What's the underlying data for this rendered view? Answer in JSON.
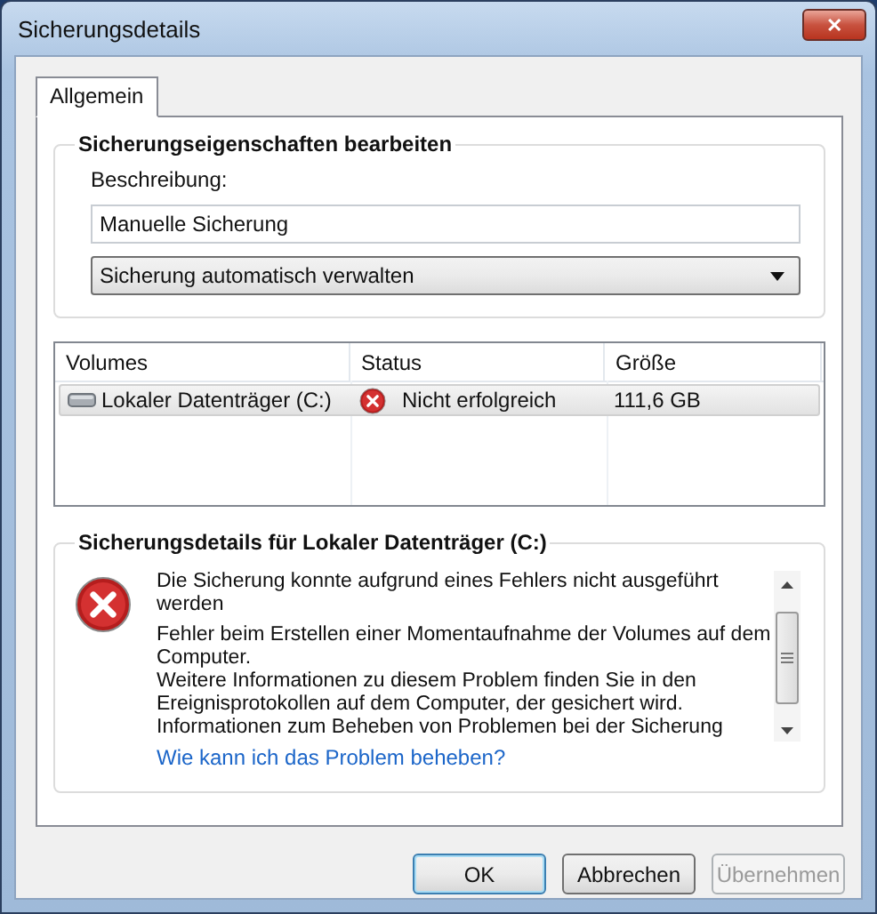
{
  "window": {
    "title": "Sicherungsdetails",
    "close_symbol": "✕"
  },
  "tabs": [
    {
      "label": "Allgemein",
      "selected": true
    }
  ],
  "properties_group": {
    "title": "Sicherungseigenschaften bearbeiten",
    "description_label": "Beschreibung:",
    "description_value": "Manuelle Sicherung",
    "dropdown_value": "Sicherung automatisch verwalten"
  },
  "table": {
    "columns": [
      "Volumes",
      "Status",
      "Größe"
    ],
    "rows": [
      {
        "volume": "Lokaler Datenträger (C:)",
        "status": "Nicht erfolgreich",
        "kind": "error",
        "size": "111,6 GB",
        "selected": true
      }
    ]
  },
  "details_group": {
    "title": "Sicherungsdetails für Lokaler Datenträger (C:)",
    "kind": "error",
    "heading": "Die Sicherung konnte aufgrund eines Fehlers nicht ausgeführt werden",
    "message": "Fehler beim Erstellen einer Momentaufnahme der Volumes auf dem Computer.\nWeitere Informationen zu diesem Problem finden Sie in den Ereignisprotokollen auf dem Computer, der gesichert wird.\nInformationen zum Beheben von Problemen bei der Sicherung",
    "help_link": "Wie kann ich das Problem beheben?"
  },
  "buttons": [
    {
      "label": "OK",
      "default": true,
      "disabled": false
    },
    {
      "label": "Abbrechen",
      "default": false,
      "disabled": false
    },
    {
      "label": "Übernehmen",
      "default": false,
      "disabled": true
    }
  ]
}
